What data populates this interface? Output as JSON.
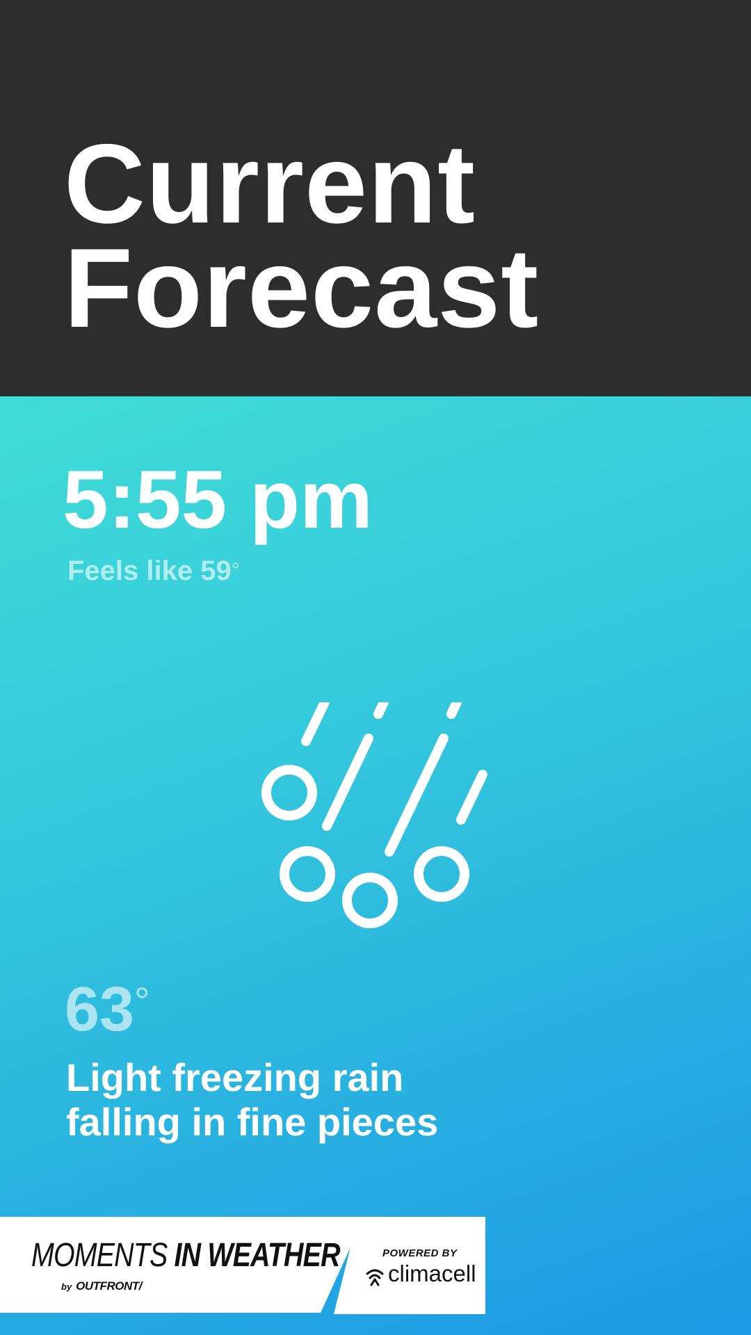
{
  "header": {
    "title_line1": "Current",
    "title_line2": "Forecast"
  },
  "forecast": {
    "time": "5:55 pm",
    "feels_like_label": "Feels like 59",
    "degree_symbol": "°",
    "weather_icon": "freezing-rain-icon",
    "temperature": "63",
    "condition_line1": "Light freezing rain",
    "condition_line2": "falling in fine pieces"
  },
  "footer": {
    "brand_part1": "MOMENTS",
    "brand_part2": "IN WEATHER",
    "by_text": "by",
    "company": "OUTFRONT/",
    "powered_by": "POWERED BY",
    "partner": "climacell"
  },
  "colors": {
    "header_bg": "#2d2d2d",
    "gradient_top": "#40dcd6",
    "gradient_bottom": "#1c98e6",
    "text": "#ffffff"
  }
}
